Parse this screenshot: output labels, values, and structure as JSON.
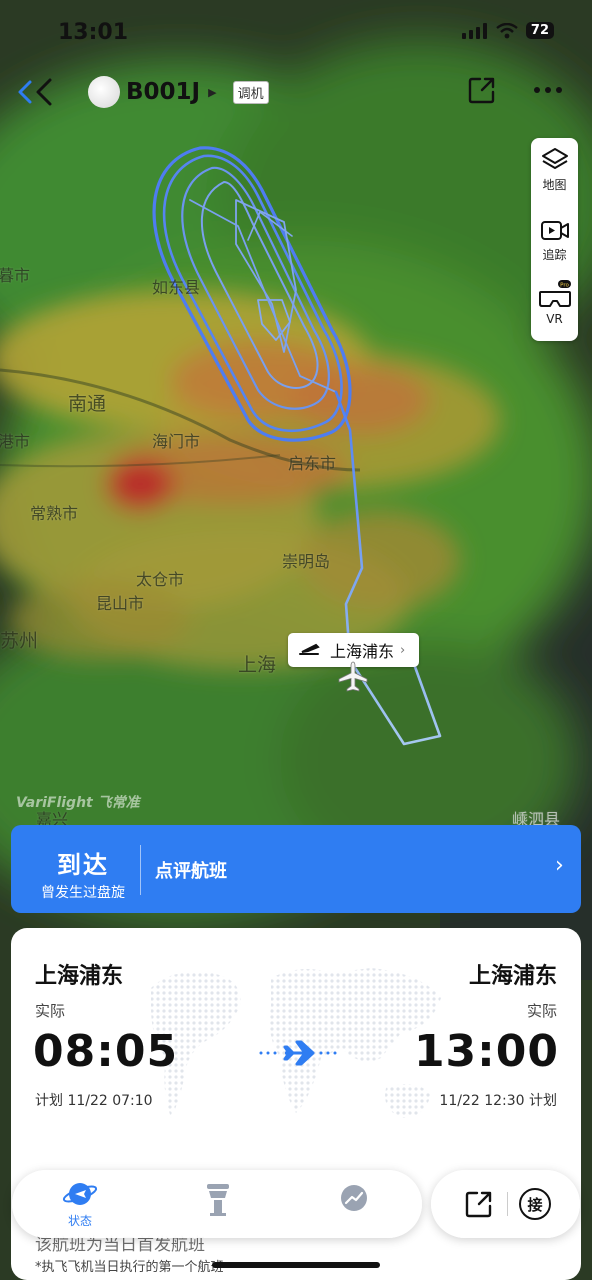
{
  "status_bar": {
    "time": "13:01",
    "battery": "72"
  },
  "header": {
    "flight_number": "B001J",
    "tag": "调机"
  },
  "tools": [
    {
      "label": "地图",
      "icon": "layers-icon"
    },
    {
      "label": "追踪",
      "icon": "video-camera-icon"
    },
    {
      "label": "VR",
      "icon": "vr-headset-icon",
      "badge": "Pro"
    }
  ],
  "map": {
    "labels": [
      "如东县",
      "南通",
      "海门市",
      "启东市",
      "常熟市",
      "崇明岛",
      "太仓市",
      "昆山市",
      "苏州",
      "上海",
      "嘉兴",
      "嵊泗县",
      "暮市",
      "港市"
    ],
    "watermark": "VariFlight 飞常准",
    "airport_callout": "上海浦东"
  },
  "arrival_banner": {
    "status": "到达",
    "sub_status": "曾发生过盘旋",
    "review_link": "点评航班"
  },
  "flight_card": {
    "departure": {
      "airport": "上海浦东",
      "label": "实际",
      "time": "08:05",
      "scheduled": "计划 11/22 07:10"
    },
    "arrival": {
      "airport": "上海浦东",
      "label": "实际",
      "time": "13:00",
      "scheduled": "11/22 12:30 计划"
    },
    "partial_row": "该航班为当日首发航班",
    "footnote": "*执飞飞机当日执行的第一个航班"
  },
  "dock": {
    "items": [
      {
        "label": "状态",
        "icon": "planet-plane-icon",
        "active": true
      },
      {
        "label": "",
        "icon": "control-tower-icon"
      },
      {
        "label": "",
        "icon": "flight-trend-icon"
      }
    ],
    "pickup_label": "接"
  },
  "colors": {
    "accent": "#2f7df2",
    "route_line": "#5b8df0"
  }
}
